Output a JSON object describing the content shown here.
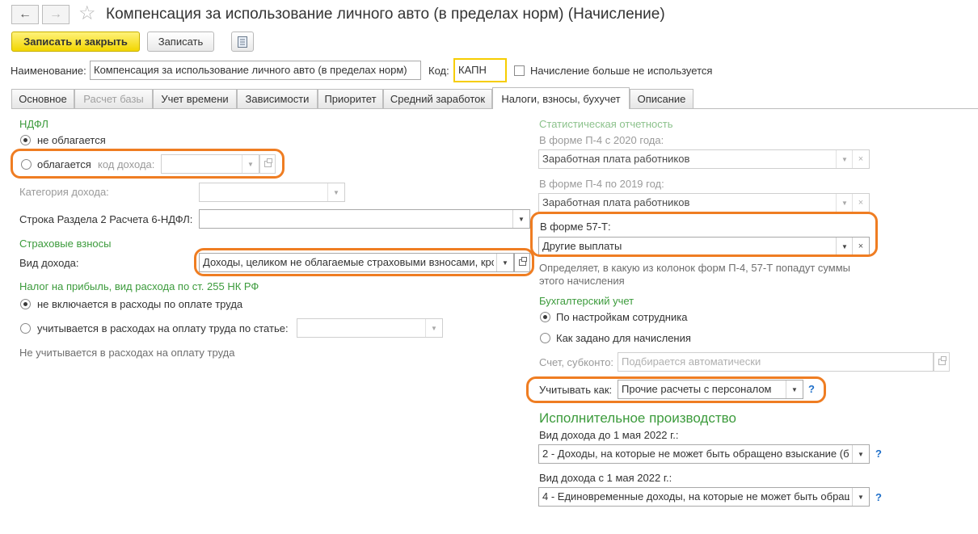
{
  "window": {
    "title": "Компенсация за использование личного авто (в пределах норм) (Начисление)"
  },
  "toolbar": {
    "save_close_label": "Записать и закрыть",
    "save_label": "Записать"
  },
  "header": {
    "name_label": "Наименование:",
    "name_value": "Компенсация за использование личного авто (в пределах норм)",
    "code_label": "Код:",
    "code_value": "КАПН",
    "unused_label": "Начисление больше не используется"
  },
  "tabs": [
    {
      "label": "Основное"
    },
    {
      "label": "Расчет базы"
    },
    {
      "label": "Учет времени"
    },
    {
      "label": "Зависимости"
    },
    {
      "label": "Приоритет"
    },
    {
      "label": "Средний заработок"
    },
    {
      "label": "Налоги, взносы, бухучет"
    },
    {
      "label": "Описание"
    }
  ],
  "left": {
    "ndfl": {
      "title": "НДФЛ",
      "not_taxed": "не облагается",
      "taxed": "облагается",
      "income_code_label": "код дохода:",
      "income_code_value": ""
    },
    "income_category": {
      "label": "Категория дохода:",
      "value": ""
    },
    "row_6ndfl": {
      "label": "Строка Раздела 2 Расчета 6-НДФЛ:",
      "value": ""
    },
    "insurance": {
      "title": "Страховые взносы",
      "income_type_label": "Вид дохода:",
      "income_type_value": "Доходы, целиком не облагаемые страховыми взносами, кро"
    },
    "profit_tax": {
      "title": "Налог на прибыль, вид расхода по ст. 255 НК РФ",
      "not_included": "не включается в расходы по оплате труда",
      "included": "учитывается в расходах на оплату труда по статье:",
      "article_value": "",
      "note": "Не учитывается в расходах на оплату труда"
    }
  },
  "right": {
    "stats": {
      "title": "Статистическая отчетность",
      "p4_2020_label": "В форме П-4 с 2020 года:",
      "p4_2020_value": "Заработная плата работников",
      "p4_2019_label": "В форме П-4 по 2019 год:",
      "p4_2019_value": "Заработная плата работников",
      "f57t_label": "В форме 57-Т:",
      "f57t_value": "Другие выплаты",
      "note": "Определяет, в какую из колонок форм П-4, 57-Т попадут суммы этого начисления"
    },
    "accounting": {
      "title": "Бухгалтерский учет",
      "by_employee": "По настройкам сотрудника",
      "as_set": "Как задано для начисления",
      "account_label": "Счет, субконто:",
      "account_placeholder": "Подбирается автоматически",
      "consider_label": "Учитывать как:",
      "consider_value": "Прочие расчеты с персоналом"
    },
    "enforcement": {
      "title": "Исполнительное производство",
      "before_label": "Вид дохода до 1 мая 2022 г.:",
      "before_value": "2 - Доходы, на которые не может быть обращено взыскание (бе",
      "after_label": "Вид дохода с 1 мая 2022 г.:",
      "after_value": "4 - Единовременные доходы, на которые не может быть обращ"
    }
  },
  "icons": {
    "back": "←",
    "forward": "→",
    "star": "☆",
    "dropdown": "▼",
    "clear": "×",
    "help": "?",
    "menu": "≡"
  },
  "colors": {
    "highlight": "#ef7d22",
    "group_title": "#3c9b3c",
    "primary_button": "#f2d600",
    "help": "#1f6fc9"
  }
}
